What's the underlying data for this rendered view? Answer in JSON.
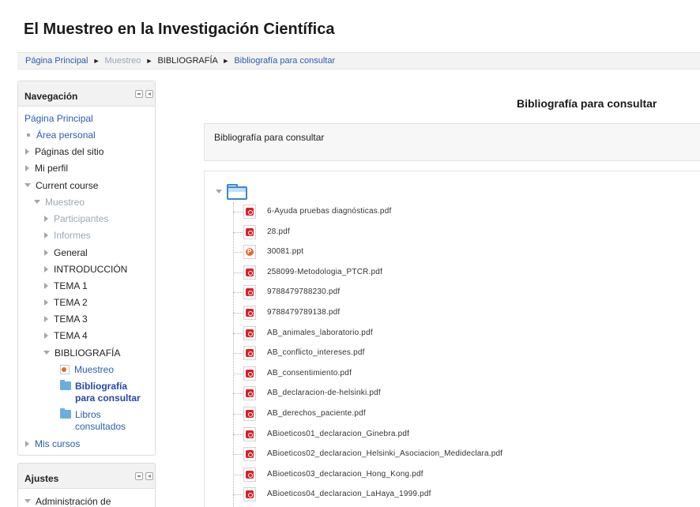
{
  "page": {
    "title": "El Muestreo en la Investigación Científica"
  },
  "breadcrumb": {
    "items": [
      "Página Principal",
      "Muestreo",
      "BIBLIOGRAFÍA",
      "Bibliografía para consultar"
    ],
    "separator": "►"
  },
  "navigation": {
    "title": "Navegación",
    "home": "Página Principal",
    "area_personal": "Área personal",
    "paginas_sitio": "Páginas del sitio",
    "mi_perfil": "Mi perfil",
    "current_course": "Current course",
    "muestreo": "Muestreo",
    "participantes": "Participantes",
    "informes": "Informes",
    "general": "General",
    "introduccion": "INTRODUCCIÓN",
    "tema1": "TEMA 1",
    "tema2": "TEMA 2",
    "tema3": "TEMA 3",
    "tema4": "TEMA 4",
    "bibliografia": "BIBLIOGRAFÍA",
    "bib_muestreo": "Muestreo",
    "bib_consultar_1": "Bibliografía",
    "bib_consultar_2": "para consultar",
    "libros_1": "Libros",
    "libros_2": "consultados",
    "mis_cursos": "Mis cursos"
  },
  "settings": {
    "title": "Ajustes",
    "admin": "Administración de"
  },
  "main": {
    "heading": "Bibliografía para consultar",
    "intro": "Bibliografía para consultar",
    "files": [
      {
        "name": "6-Ayuda pruebas diagnósticas.pdf",
        "type": "pdf"
      },
      {
        "name": "28.pdf",
        "type": "pdf"
      },
      {
        "name": "30081.ppt",
        "type": "ppt"
      },
      {
        "name": "258099-Metodologia_PTCR.pdf",
        "type": "pdf"
      },
      {
        "name": "9788479788230.pdf",
        "type": "pdf"
      },
      {
        "name": "9788479789138.pdf",
        "type": "pdf"
      },
      {
        "name": "AB_animales_laboratorio.pdf",
        "type": "pdf"
      },
      {
        "name": "AB_conflicto_intereses.pdf",
        "type": "pdf"
      },
      {
        "name": "AB_consentimiento.pdf",
        "type": "pdf"
      },
      {
        "name": "AB_declaracion-de-helsinki.pdf",
        "type": "pdf"
      },
      {
        "name": "AB_derechos_paciente.pdf",
        "type": "pdf"
      },
      {
        "name": "ABioeticos01_declaracion_Ginebra.pdf",
        "type": "pdf"
      },
      {
        "name": "ABioeticos02_declaracion_Helsinki_Asociacion_Medideclara.pdf",
        "type": "pdf"
      },
      {
        "name": "ABioeticos03_declaracion_Hong_Kong.pdf",
        "type": "pdf"
      },
      {
        "name": "ABioeticos04_declaracion_LaHaya_1999.pdf",
        "type": "pdf"
      }
    ]
  }
}
